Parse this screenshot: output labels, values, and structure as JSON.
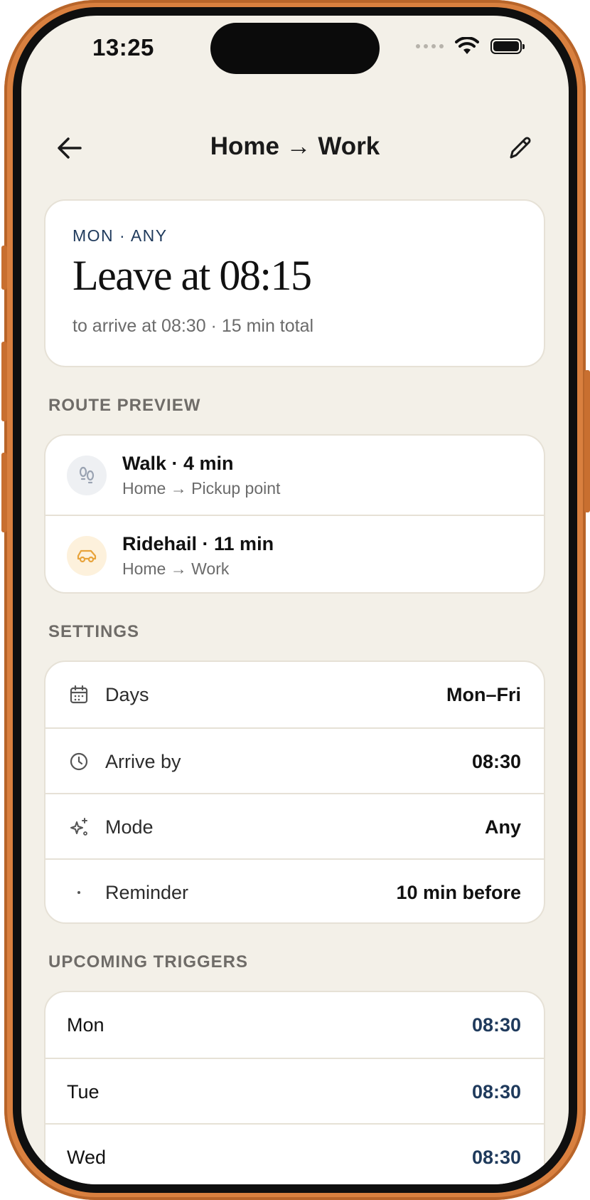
{
  "status_bar": {
    "time": "13:25"
  },
  "nav": {
    "title": "Home → Work",
    "back_icon": "arrow-left-icon",
    "edit_icon": "pencil-icon"
  },
  "summary": {
    "eyebrow": "MON · ANY",
    "headline": "Leave at 08:15",
    "subtitle": "to arrive at 08:30 · 15 min total"
  },
  "route_preview": {
    "label": "ROUTE PREVIEW",
    "steps": [
      {
        "title": "Walk · 4 min",
        "subtitle": "Home → Pickup point",
        "icon": "footsteps-icon",
        "color": "#9aa3b2"
      },
      {
        "title": "Ridehail · 11 min",
        "subtitle": "Home → Work",
        "icon": "car-icon",
        "color": "#e8a33a"
      }
    ]
  },
  "settings": {
    "label": "SETTINGS",
    "rows": [
      {
        "label": "Days",
        "value": "Mon–Fri",
        "icon": "calendar-icon"
      },
      {
        "label": "Arrive by",
        "value": "08:30",
        "icon": "clock-icon"
      },
      {
        "label": "Mode",
        "value": "Any",
        "icon": "sparkles-icon"
      },
      {
        "label": "Reminder",
        "value": "10 min before",
        "icon": "dot-icon"
      }
    ]
  },
  "triggers": {
    "label": "UPCOMING TRIGGERS",
    "rows": [
      {
        "day": "Mon",
        "time": "08:30"
      },
      {
        "day": "Tue",
        "time": "08:30"
      },
      {
        "day": "Wed",
        "time": "08:30"
      }
    ]
  },
  "colors": {
    "accent_navy": "#1f3a5c",
    "background": "#f3f0e8",
    "frame": "#d9803f"
  }
}
